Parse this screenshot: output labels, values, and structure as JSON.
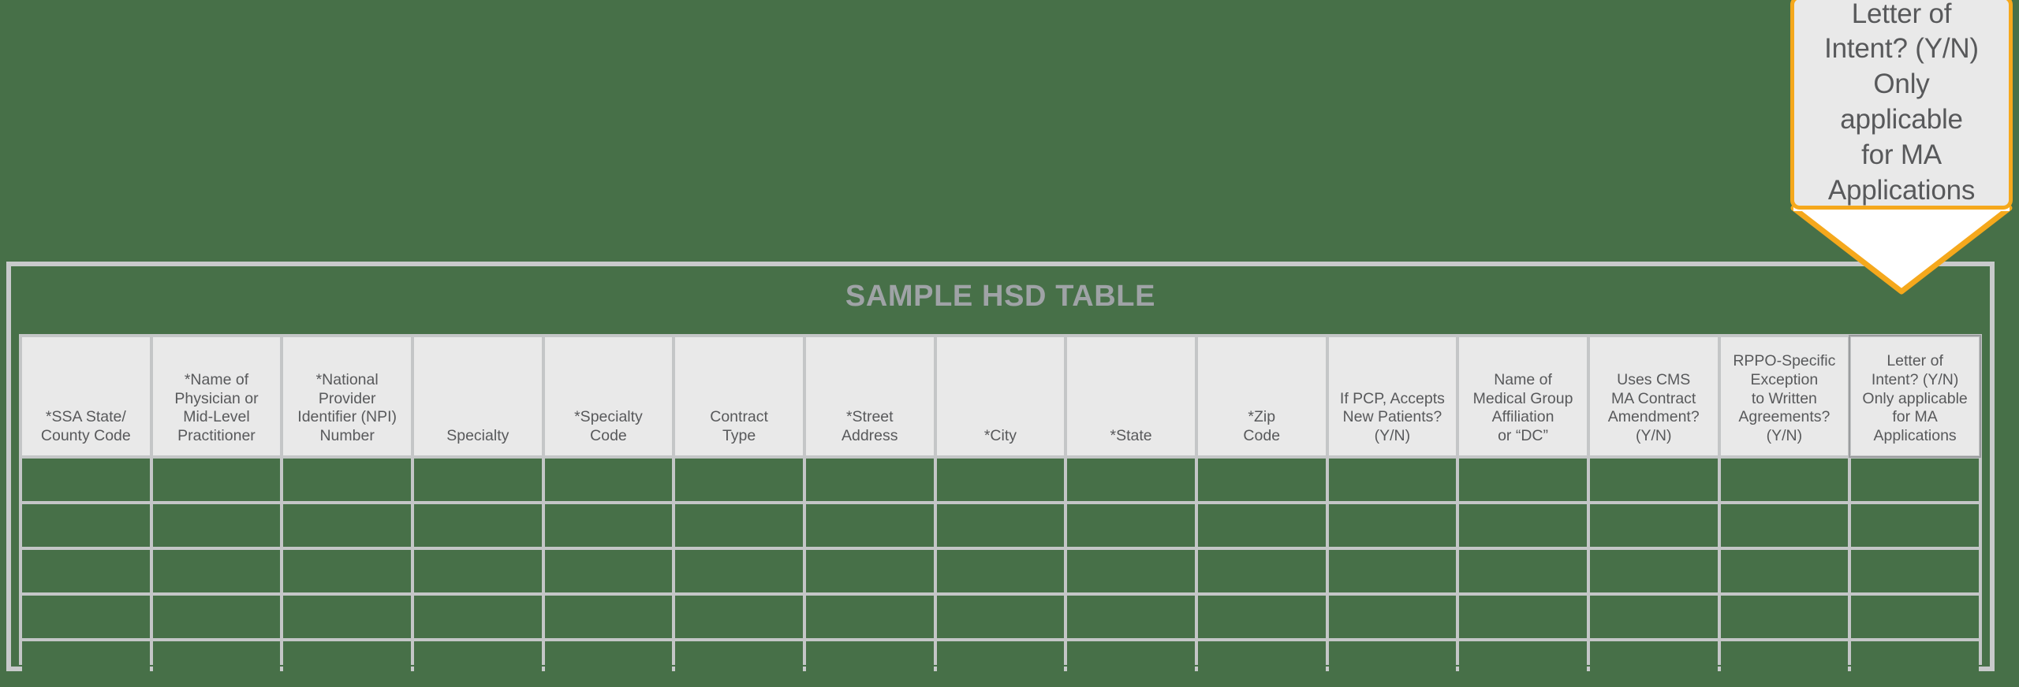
{
  "colors": {
    "background_green": "#477048",
    "header_cell_gray": "#e9e9e9",
    "gridline_gray": "#c4c6c7",
    "frame_gray": "#c8cacb",
    "text_gray": "#58595b",
    "title_gray": "#9fa3a6",
    "callout_accent_orange": "#f5a81c"
  },
  "callout": {
    "text": "Letter of\nIntent? (Y/N)\nOnly applicable\nfor MA\nApplications"
  },
  "table": {
    "title": "SAMPLE HSD TABLE",
    "columns": [
      {
        "label": "*SSA State/\nCounty Code",
        "highlighted": false
      },
      {
        "label": "*Name of\nPhysician or\nMid-Level\nPractitioner",
        "highlighted": false
      },
      {
        "label": "*National\nProvider\nIdentifier (NPI)\nNumber",
        "highlighted": false
      },
      {
        "label": "Specialty",
        "highlighted": false
      },
      {
        "label": "*Specialty\nCode",
        "highlighted": false
      },
      {
        "label": "Contract\nType",
        "highlighted": false
      },
      {
        "label": "*Street\nAddress",
        "highlighted": false
      },
      {
        "label": "*City",
        "highlighted": false
      },
      {
        "label": "*State",
        "highlighted": false
      },
      {
        "label": "*Zip\nCode",
        "highlighted": false
      },
      {
        "label": "If PCP, Accepts\nNew Patients?\n(Y/N)",
        "highlighted": false
      },
      {
        "label": "Name of\nMedical Group\nAffiliation\nor “DC”",
        "highlighted": false
      },
      {
        "label": "Uses CMS\nMA Contract\nAmendment?\n(Y/N)",
        "highlighted": false
      },
      {
        "label": "RPPO-Specific\nException\nto Written\nAgreements?\n(Y/N)",
        "highlighted": false
      },
      {
        "label": "Letter of\nIntent? (Y/N)\nOnly applicable\nfor MA\nApplications",
        "highlighted": true
      }
    ],
    "rows": [
      [
        "",
        "",
        "",
        "",
        "",
        "",
        "",
        "",
        "",
        "",
        "",
        "",
        "",
        "",
        ""
      ],
      [
        "",
        "",
        "",
        "",
        "",
        "",
        "",
        "",
        "",
        "",
        "",
        "",
        "",
        "",
        ""
      ],
      [
        "",
        "",
        "",
        "",
        "",
        "",
        "",
        "",
        "",
        "",
        "",
        "",
        "",
        "",
        ""
      ],
      [
        "",
        "",
        "",
        "",
        "",
        "",
        "",
        "",
        "",
        "",
        "",
        "",
        "",
        "",
        ""
      ],
      [
        "",
        "",
        "",
        "",
        "",
        "",
        "",
        "",
        "",
        "",
        "",
        "",
        "",
        "",
        ""
      ]
    ]
  }
}
